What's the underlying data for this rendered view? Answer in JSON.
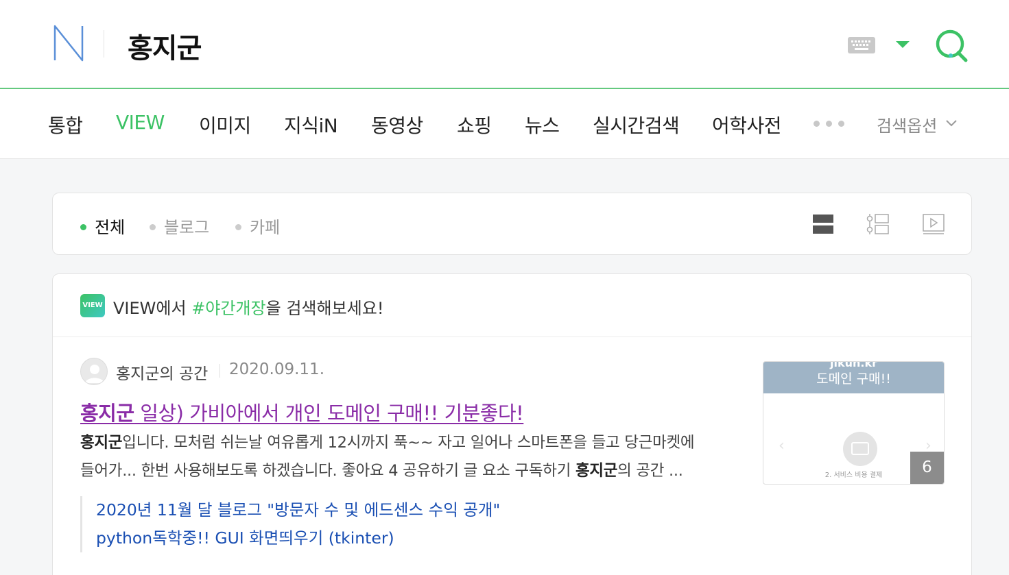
{
  "header": {
    "logo_letter": "N",
    "query": "홍지군"
  },
  "tabs": [
    {
      "label": "통합",
      "active": false
    },
    {
      "label": "VIEW",
      "active": true
    },
    {
      "label": "이미지",
      "active": false
    },
    {
      "label": "지식iN",
      "active": false
    },
    {
      "label": "동영상",
      "active": false
    },
    {
      "label": "쇼핑",
      "active": false
    },
    {
      "label": "뉴스",
      "active": false
    },
    {
      "label": "실시간검색",
      "active": false
    },
    {
      "label": "어학사전",
      "active": false
    }
  ],
  "search_options_label": "검색옵션",
  "filters": [
    {
      "label": "전체",
      "active": true
    },
    {
      "label": "블로그",
      "active": false
    },
    {
      "label": "카페",
      "active": false
    }
  ],
  "view_icons": [
    "list-view-icon",
    "timeline-view-icon",
    "video-view-icon"
  ],
  "suggestion": {
    "badge": "VIEW",
    "prefix": "VIEW에서 ",
    "tag": "#야간개장",
    "suffix": "을 검색해보세요!"
  },
  "result": {
    "author": "홍지군의 공간",
    "date": "2020.09.11.",
    "title_bold": "홍지군",
    "title_rest": " 일상) 가비아에서 개인 도메인 구매!! 기분좋다!",
    "desc_line1_bold": "홍지군",
    "desc_line1_rest": "입니다. 모처럼 쉬는날 여유롭게 12시까지 푹~~ 자고 일어나 스마트폰을 들고 당근마켓에",
    "desc_line2_pre": "들어가... 한번 사용해보도록 하겠습니다. 좋아요 4 공유하기 글 요소 구독하기 ",
    "desc_line2_bold": "홍지군",
    "desc_line2_post": "의 공간 ...",
    "related": [
      "2020년 11월 달 블로그 \"방문자 수 및 에드센스 수익 공개\"",
      "python독학중!! GUI 화면띄우기 (tkinter)"
    ],
    "thumbnail": {
      "line1": "jikun.kr",
      "line2": "도메인 구매!!",
      "caption": "2. 서비스 비용 결제",
      "count": "6"
    }
  },
  "colors": {
    "brand_green": "#3cc265",
    "visited_title": "#8a2ca7",
    "link_blue": "#1a4fb3"
  }
}
